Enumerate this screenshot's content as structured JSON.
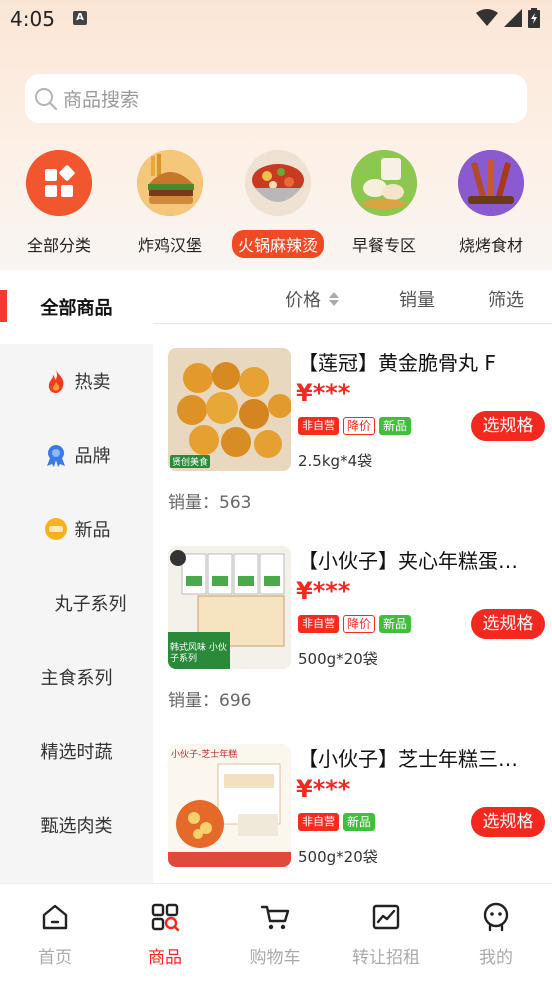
{
  "status_bar": {
    "time": "4:05",
    "notif_icon": "A"
  },
  "search": {
    "placeholder": "商品搜索"
  },
  "categories": [
    {
      "label": "全部分类",
      "icon": "grid-icon",
      "active": false
    },
    {
      "label": "炸鸡汉堡",
      "icon": "burger-image",
      "active": false
    },
    {
      "label": "火锅麻辣烫",
      "icon": "hotpot-image",
      "active": true
    },
    {
      "label": "早餐专区",
      "icon": "breakfast-image",
      "active": false
    },
    {
      "label": "烧烤食材",
      "icon": "bbq-image",
      "active": false
    }
  ],
  "sidebar": {
    "items": [
      {
        "label": "全部商品",
        "icon": "",
        "active": true
      },
      {
        "label": "热卖",
        "icon": "fire-icon",
        "active": false
      },
      {
        "label": "品牌",
        "icon": "badge-icon",
        "active": false
      },
      {
        "label": "新品",
        "icon": "new-icon",
        "active": false
      },
      {
        "label": "丸子系列",
        "icon": "",
        "active": false
      },
      {
        "label": "主食系列",
        "icon": "",
        "active": false
      },
      {
        "label": "精选时蔬",
        "icon": "",
        "active": false
      },
      {
        "label": "甄选肉类",
        "icon": "",
        "active": false
      }
    ]
  },
  "filters": {
    "price": "价格",
    "sales": "销量",
    "filter": "筛选"
  },
  "products": [
    {
      "title": "【莲冠】黄金脆骨丸 F",
      "price": "¥***",
      "tags": [
        "非自营",
        "降价",
        "新品"
      ],
      "spec": "2.5kg*4袋",
      "button": "选规格",
      "sales": "销量：563",
      "img_caption": "贤创美食"
    },
    {
      "title": "【小伙子】夹心年糕蛋…",
      "price": "¥***",
      "tags": [
        "非自营",
        "降价",
        "新品"
      ],
      "spec": "500g*20袋",
      "button": "选规格",
      "sales": "销量：696",
      "img_caption": "韩式风味 小伙子系列"
    },
    {
      "title": "【小伙子】芝士年糕三…",
      "price": "¥***",
      "tags": [
        "非自营",
        "新品"
      ],
      "spec": "500g*20袋",
      "button": "选规格",
      "sales": "",
      "img_caption": "小伙子-芝士年糕"
    }
  ],
  "bottom_nav": [
    {
      "label": "首页",
      "icon": "home-icon",
      "active": false
    },
    {
      "label": "商品",
      "icon": "products-icon",
      "active": true
    },
    {
      "label": "购物车",
      "icon": "cart-icon",
      "active": false
    },
    {
      "label": "转让招租",
      "icon": "chart-icon",
      "active": false
    },
    {
      "label": "我的",
      "icon": "profile-icon",
      "active": false
    }
  ],
  "colors": {
    "accent": "#f3281e",
    "active_pill": "#ef4a24",
    "green_tag": "#3fbf3a"
  }
}
